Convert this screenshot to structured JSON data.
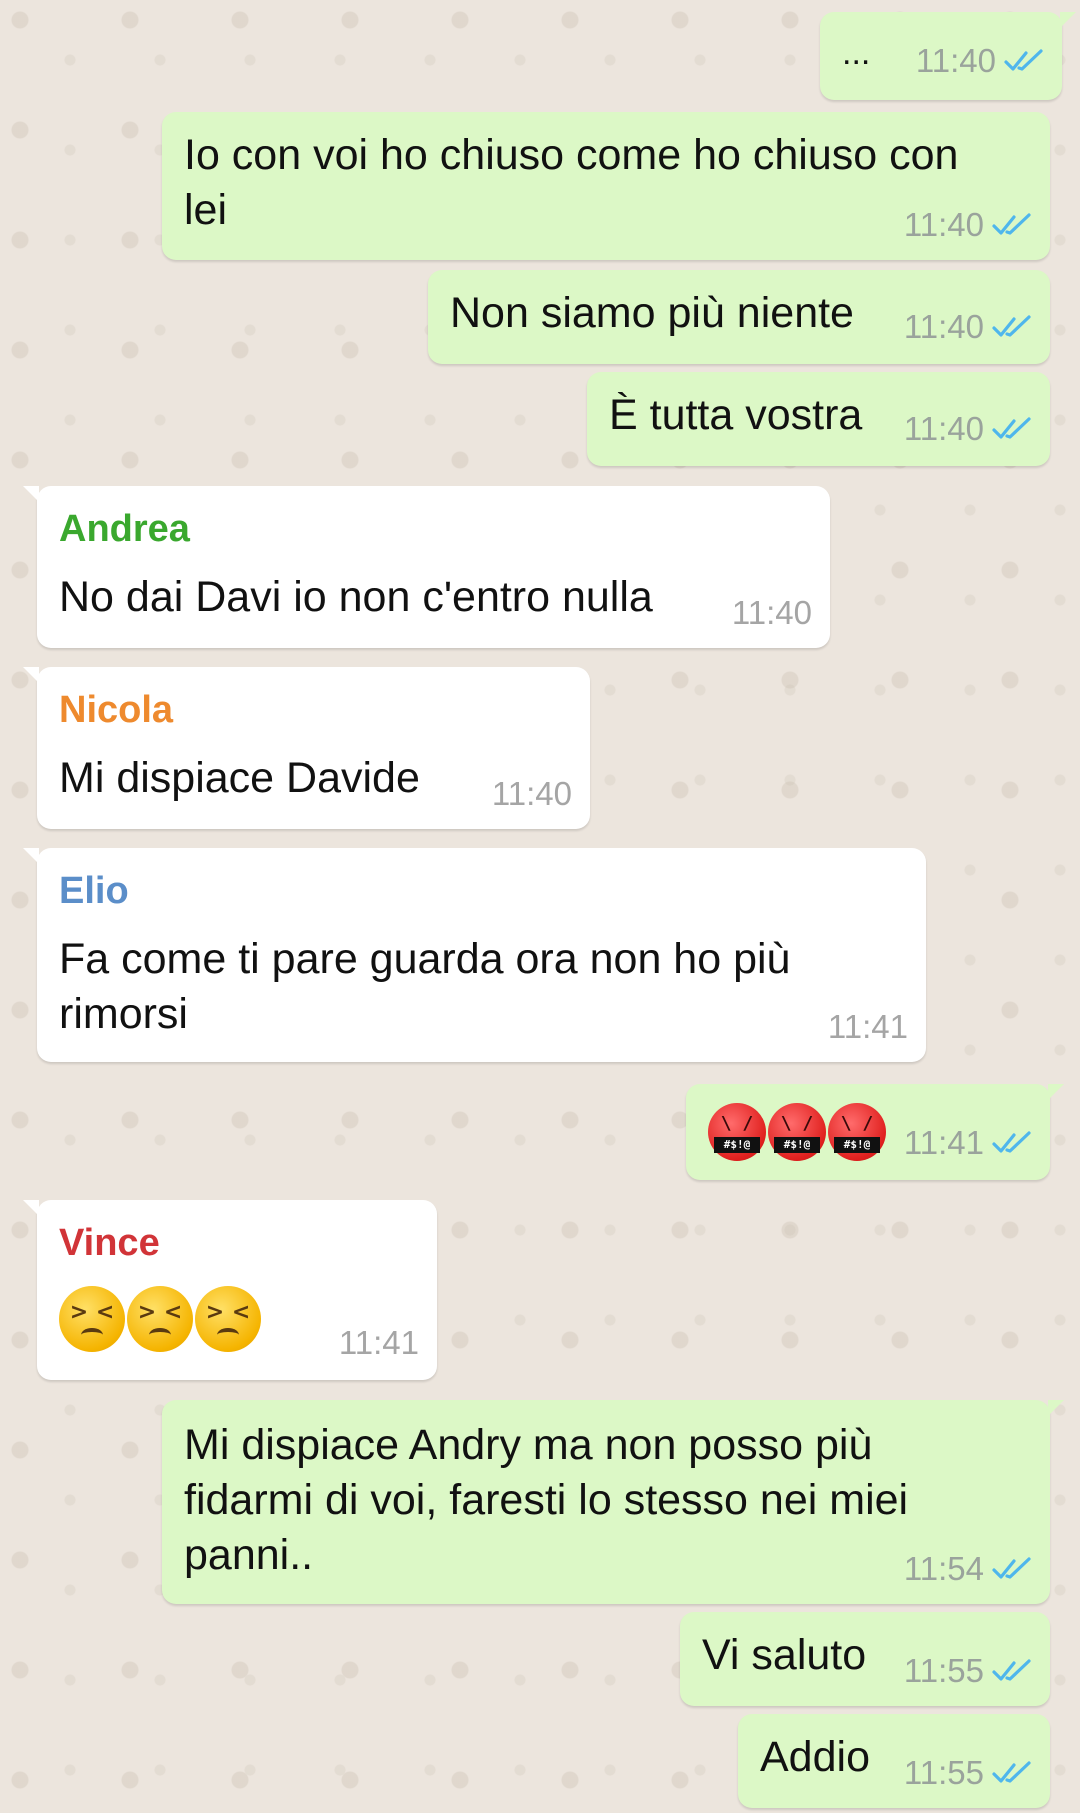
{
  "colors": {
    "outgoing_bubble": "#dcf8c6",
    "incoming_bubble": "#ffffff",
    "read_tick": "#4fb6ec",
    "chat_background": "#ece5dd"
  },
  "messages": [
    {
      "direction": "out",
      "text": "...",
      "time": "11:40",
      "status_icon": "double-check-read-icon"
    },
    {
      "direction": "out",
      "text_line1": "Io con voi ho chiuso come ho chiuso con",
      "text_line2": "lei",
      "time": "11:40",
      "status_icon": "double-check-read-icon"
    },
    {
      "direction": "out",
      "text": "Non siamo più niente",
      "time": "11:40",
      "status_icon": "double-check-read-icon"
    },
    {
      "direction": "out",
      "text": "È tutta vostra",
      "time": "11:40",
      "status_icon": "double-check-read-icon"
    },
    {
      "direction": "in",
      "sender": "Andrea",
      "sender_color": "#3aa82e",
      "text": "No dai Davi io non c'entro nulla",
      "time": "11:40"
    },
    {
      "direction": "in",
      "sender": "Nicola",
      "sender_color": "#ee8a2e",
      "text": "Mi dispiace Davide",
      "time": "11:40"
    },
    {
      "direction": "in",
      "sender": "Elio",
      "sender_color": "#5b8ec9",
      "text_line1": "Fa come ti pare guarda ora non ho più",
      "text_line2": "rimorsi",
      "time": "11:41"
    },
    {
      "direction": "out",
      "emoji": [
        "face-with-symbols-on-mouth-emoji",
        "face-with-symbols-on-mouth-emoji",
        "face-with-symbols-on-mouth-emoji"
      ],
      "time": "11:41",
      "status_icon": "double-check-read-icon"
    },
    {
      "direction": "in",
      "sender": "Vince",
      "sender_color": "#d13438",
      "emoji": [
        "persevering-face-emoji",
        "persevering-face-emoji",
        "persevering-face-emoji"
      ],
      "time": "11:41"
    },
    {
      "direction": "out",
      "text_line1": "Mi dispiace Andry ma non posso più",
      "text_line2": "fidarmi di voi, faresti lo stesso nei miei",
      "text_line3": "panni..",
      "time": "11:54",
      "status_icon": "double-check-read-icon"
    },
    {
      "direction": "out",
      "text": "Vi saluto",
      "time": "11:55",
      "status_icon": "double-check-read-icon"
    },
    {
      "direction": "out",
      "text": "Addio",
      "time": "11:55",
      "status_icon": "double-check-read-icon"
    }
  ]
}
